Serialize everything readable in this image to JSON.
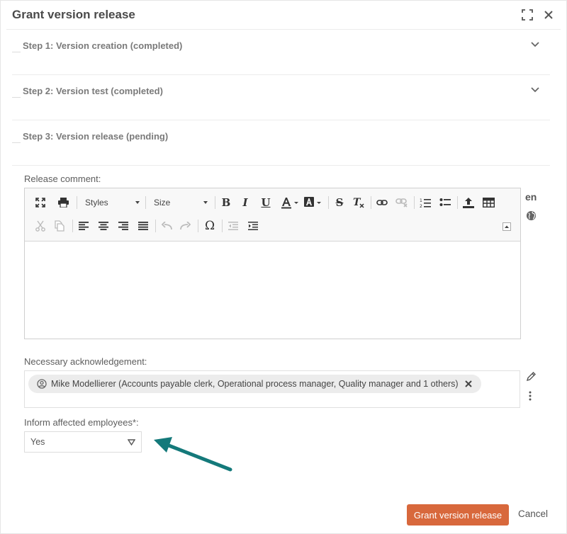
{
  "dialog": {
    "title": "Grant version release"
  },
  "steps": [
    {
      "label": "Step 1: Version creation (completed)",
      "expandable": true
    },
    {
      "label": "Step 2: Version test (completed)",
      "expandable": true
    },
    {
      "label": "Step 3: Version release (pending)",
      "expandable": false
    }
  ],
  "release_comment": {
    "label": "Release comment:",
    "styles_label": "Styles",
    "size_label": "Size",
    "language": "en",
    "value": ""
  },
  "acknowledgement": {
    "label": "Necessary acknowledgement:",
    "chip": "Mike Modellierer (Accounts payable clerk, Operational process manager, Quality manager and 1 others)"
  },
  "inform": {
    "label": "Inform affected employees*:",
    "selected": "Yes"
  },
  "footer": {
    "primary_label": "Grant version release",
    "cancel_label": "Cancel"
  },
  "colors": {
    "primary": "#d8683c",
    "annotation_arrow": "#14797a"
  }
}
